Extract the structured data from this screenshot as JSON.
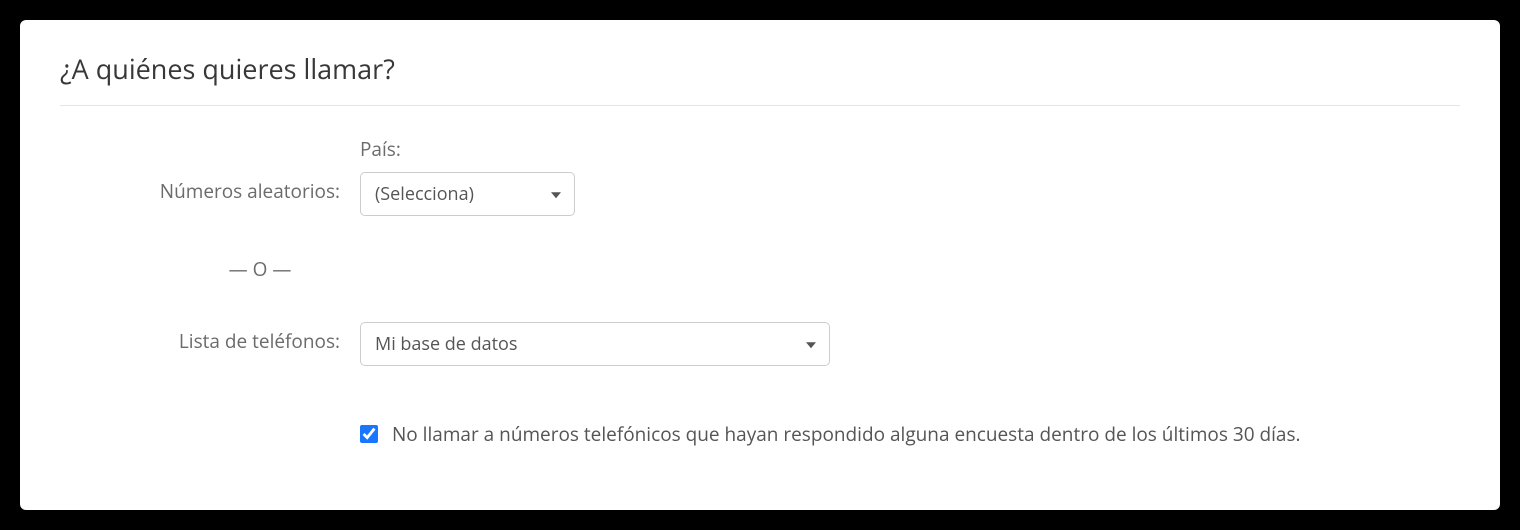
{
  "title": "¿A quiénes quieres llamar?",
  "random_numbers": {
    "label": "Números aleatorios:",
    "country_label": "País:",
    "country_select": {
      "selected": "(Selecciona)"
    }
  },
  "or_separator": "— O —",
  "phone_list": {
    "label": "Lista de teléfonos:",
    "select": {
      "selected": "Mi base de datos"
    }
  },
  "no_call": {
    "checked": true,
    "label": "No llamar a números telefónicos que hayan respondido alguna encuesta dentro de los últimos 30 días."
  }
}
